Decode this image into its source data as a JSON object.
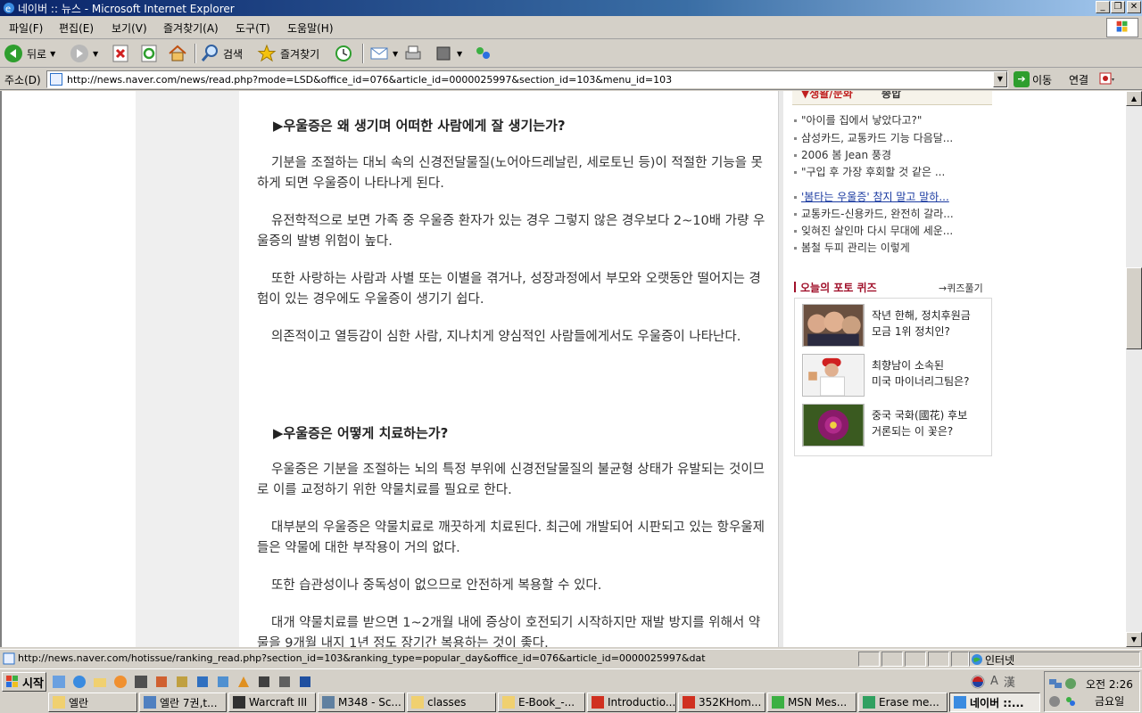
{
  "window": {
    "title": "네이버 :: 뉴스 - Microsoft Internet Explorer"
  },
  "menu": [
    "파일(F)",
    "편집(E)",
    "보기(V)",
    "즐겨찾기(A)",
    "도구(T)",
    "도움말(H)"
  ],
  "toolbar": {
    "back": "뒤로",
    "search": "검색",
    "favorites": "즐겨찾기"
  },
  "address": {
    "label": "주소(D)",
    "url": "http://news.naver.com/news/read.php?mode=LSD&office_id=076&article_id=0000025997&section_id=103&menu_id=103",
    "go": "이동",
    "links": "연결"
  },
  "article": {
    "heading1": "▶우울증은 왜 생기며 어떠한 사람에게 잘 생기는가?",
    "p1": "기분을 조절하는 대뇌 속의 신경전달물질(노어아드레날린, 세로토닌 등)이 적절한 기능을 못하게 되면 우울증이 나타나게 된다.",
    "p2": "유전학적으로 보면 가족 중 우울증 환자가 있는 경우 그렇지 않은 경우보다 2~10배 가량 우울증의 발병 위험이 높다.",
    "p3": "또한 사랑하는 사람과 사별 또는 이별을 겪거나, 성장과정에서 부모와 오랫동안 떨어지는 경험이 있는 경우에도 우울증이 생기기 쉽다.",
    "p4": "의존적이고 열등감이 심한 사람, 지나치게 양심적인 사람들에게서도 우울증이 나타난다.",
    "heading2": "▶우울증은 어떻게 치료하는가?",
    "p5": "우울증은 기분을 조절하는 뇌의 특정 부위에 신경전달물질의 불균형 상태가 유발되는 것이므로 이를 교정하기 위한 약물치료를 필요로 한다.",
    "p6": "대부분의 우울증은 약물치료로 깨끗하게 치료된다. 최근에 개발되어 시판되고 있는 항우울제들은 약물에 대한 부작용이 거의 없다.",
    "p7": "또한 습관성이나 중독성이 없으므로 안전하게 복용할 수 있다.",
    "p8": "대개 약물치료를 받으면 1~2개월 내에 증상이 호전되기 시작하지만 재발 방지를 위해서 약물을 9개월 내지 1년 정도 장기간 복용하는 것이 좋다."
  },
  "sidebar": {
    "tab_active": "▼생활/문화",
    "tab_other": "종합",
    "news": [
      "\"아이를 집에서 낳았다고?\"",
      "삼성카드, 교통카드 기능 다음달...",
      "2006 봄 Jean 풍경",
      "\"구입 후 가장 후회할 것 같은 ...",
      "'봄타는 우울증' 참지 말고 말하...",
      "교통카드-신용카드, 완전히 갈라...",
      "잊혀진 살인마 다시 무대에 세운...",
      "봄철 두피 관리는 이렇게"
    ],
    "quiz_title": "오늘의 포토 퀴즈",
    "quiz_more": "→퀴즈풀기",
    "quiz": [
      {
        "line1": "작년 한해, 정치후원금",
        "line2": "모금 1위 정치인?"
      },
      {
        "line1": "최향남이 소속된",
        "line2": "미국 마이너리그팀은?"
      },
      {
        "line1": "중국 국화(國花) 후보",
        "line2": "거론되는 이 꽃은?"
      }
    ]
  },
  "status": {
    "text": "http://news.naver.com/hotissue/ranking_read.php?section_id=103&ranking_type=popular_day&office_id=076&article_id=0000025997&dat",
    "zone": "인터넷"
  },
  "taskbar": {
    "start": "시작",
    "buttons": [
      "엘란",
      "엘란 7권,t...",
      "Warcraft III",
      "M348 - Sc...",
      "classes",
      "E-Book_-...",
      "Introductio...",
      "352KHom...",
      "MSN Mes...",
      "Erase me...",
      "네이버 ::..."
    ],
    "ime": [
      "A",
      "漢"
    ],
    "time": "오전 2:26",
    "day": "금요일"
  },
  "colors": {
    "titlebar": "#0a246a",
    "quiz_red": "#a0102a",
    "link_blue": "#1a3aa0"
  }
}
